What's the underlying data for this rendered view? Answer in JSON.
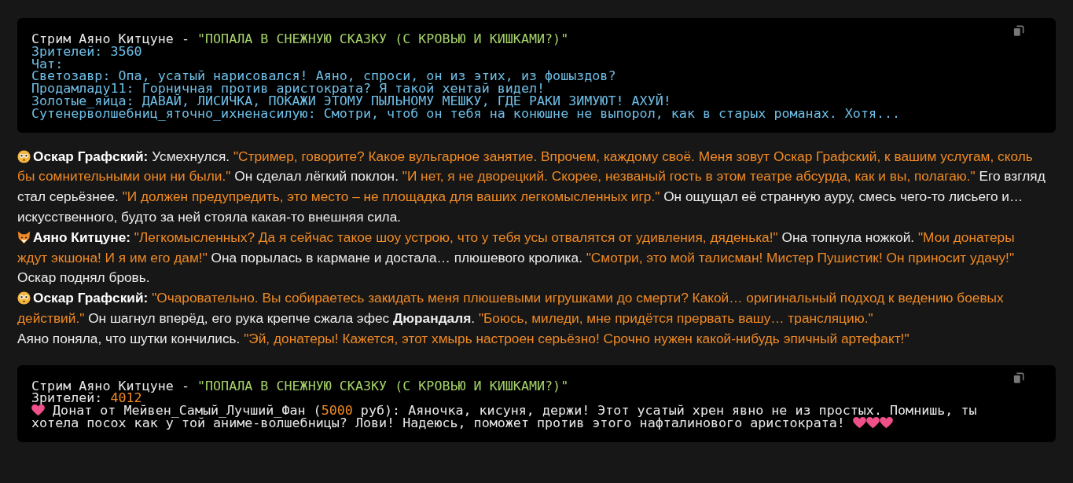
{
  "code_blocks": [
    {
      "lines": [
        [
          {
            "kind": "plain",
            "text": "Стрим Аяно Китцуне - "
          },
          {
            "kind": "string",
            "text": "\"ПОПАЛА В СНЕЖНУЮ СКАЗКУ (С КРОВЬЮ И КИШКАМИ?)\""
          }
        ],
        [
          {
            "kind": "info",
            "text": "Зрителей: 3560"
          }
        ],
        [
          {
            "kind": "info",
            "text": "Чат:"
          }
        ],
        [
          {
            "kind": "info",
            "text": "Светозавр: Опа, усатый нарисовался! Аяно, спроси, он из этих, из фошыздов?"
          }
        ],
        [
          {
            "kind": "info",
            "text": "Продамладу11: Горничная против аристократа? Я такой хентай видел!"
          }
        ],
        [
          {
            "kind": "info",
            "text": "Золотые_яйца: ДАВАЙ, ЛИСИЧКА, ПОКАЖИ ЭТОМУ ПЫЛЬНОМУ МЕШКУ, ГДЕ РАКИ ЗИМУЮТ! АХУЙ!"
          }
        ],
        [
          {
            "kind": "info",
            "text": "Сутенерволшебниц_яточно_ихненасилую: Смотри, чтоб он тебя на конюшне не выпорол, как в старых романах. Хотя..."
          }
        ]
      ]
    }
  ],
  "story": [
    [
      {
        "kind": "face_icon"
      },
      {
        "kind": "name",
        "text": "Оскар Графский:"
      },
      {
        "kind": "narration",
        "text": "Усмехнулся. "
      },
      {
        "kind": "speech",
        "text": "\"Стример, говорите? Какое вульгарное занятие. Впрочем, каждому своё. Меня зовут Оскар Графский, к вашим услугам, сколь бы сомнительными они ни были.\""
      },
      {
        "kind": "narration",
        "text": " Он сделал лёгкий поклон. "
      },
      {
        "kind": "speech",
        "text": "\"И нет, я не дворецкий. Скорее, незваный гость в этом театре абсурда, как и вы, полагаю.\""
      },
      {
        "kind": "narration",
        "text": " Его взгляд стал серьёзнее. "
      },
      {
        "kind": "speech",
        "text": "\"И должен предупредить, это место – не площадка для ваших легкомысленных игр.\""
      },
      {
        "kind": "narration",
        "text": " Он ощущал её странную ауру, смесь чего-то лисьего и… искусственного, будто за ней стояла какая-то внешняя сила."
      }
    ],
    [
      {
        "kind": "fox_icon"
      },
      {
        "kind": "name",
        "text": "Аяно Китцуне:"
      },
      {
        "kind": "speech",
        "text": "\"Легкомысленных? Да я сейчас такое шоу устрою, что у тебя усы отвалятся от удивления, дяденька!\""
      },
      {
        "kind": "narration",
        "text": " Она топнула ножкой. "
      },
      {
        "kind": "speech",
        "text": "\"Мои донатеры ждут экшона! И я им его дам!\""
      },
      {
        "kind": "narration",
        "text": " Она порылась в кармане и достала… плюшевого кролика. "
      },
      {
        "kind": "speech",
        "text": "\"Смотри, это мой талисман! Мистер Пушистик! Он приносит удачу!\""
      }
    ],
    [
      {
        "kind": "narration",
        "text": "Оскар поднял бровь."
      }
    ],
    [
      {
        "kind": "face_icon"
      },
      {
        "kind": "name",
        "text": "Оскар Графский:"
      },
      {
        "kind": "speech",
        "text": "\"Очаровательно. Вы собираетесь закидать меня плюшевыми игрушками до смерти? Какой… оригинальный подход к ведению боевых действий.\""
      },
      {
        "kind": "narration",
        "text": " Он шагнул вперёд, его рука крепче сжала эфес **Дюрандаля**. "
      },
      {
        "kind": "speech",
        "text": "\"Боюсь, миледи, мне придётся прервать вашу… трансляцию.\""
      }
    ],
    [
      {
        "kind": "narration",
        "text": "Аяно поняла, что шутки кончились. "
      },
      {
        "kind": "speech",
        "text": "\"Эй, донатеры! Кажется, этот хмырь настроен серьёзно! Срочно нужен какой-нибудь эпичный артефакт!\""
      }
    ]
  ],
  "code_blocks_after": [
    {
      "lines": [
        [
          {
            "kind": "plain",
            "text": "Стрим Аяно Китцуне - "
          },
          {
            "kind": "string",
            "text": "\"ПОПАЛА В СНЕЖНУЮ СКАЗКУ (С КРОВЬЮ И КИШКАМИ?)\""
          }
        ],
        [
          {
            "kind": "plain",
            "text": "Зрителей: "
          },
          {
            "kind": "number",
            "text": "4012"
          }
        ],
        [
          {
            "kind": "heart_icon"
          },
          {
            "kind": "plain",
            "text": " Донат от Мейвен_Самый_Лучший_Фан ("
          },
          {
            "kind": "number",
            "text": "5000"
          },
          {
            "kind": "plain",
            "text": " руб): Аяночка, кисуня, держи! Этот усатый хрен явно не из простых. Помнишь, ты хотела посох как у той аниме-волшебницы? Лови! Надеюсь, поможет против этого нафталинового аристократа! "
          },
          {
            "kind": "heart_icon"
          },
          {
            "kind": "heart_icon"
          },
          {
            "kind": "heart_icon"
          }
        ]
      ]
    }
  ]
}
